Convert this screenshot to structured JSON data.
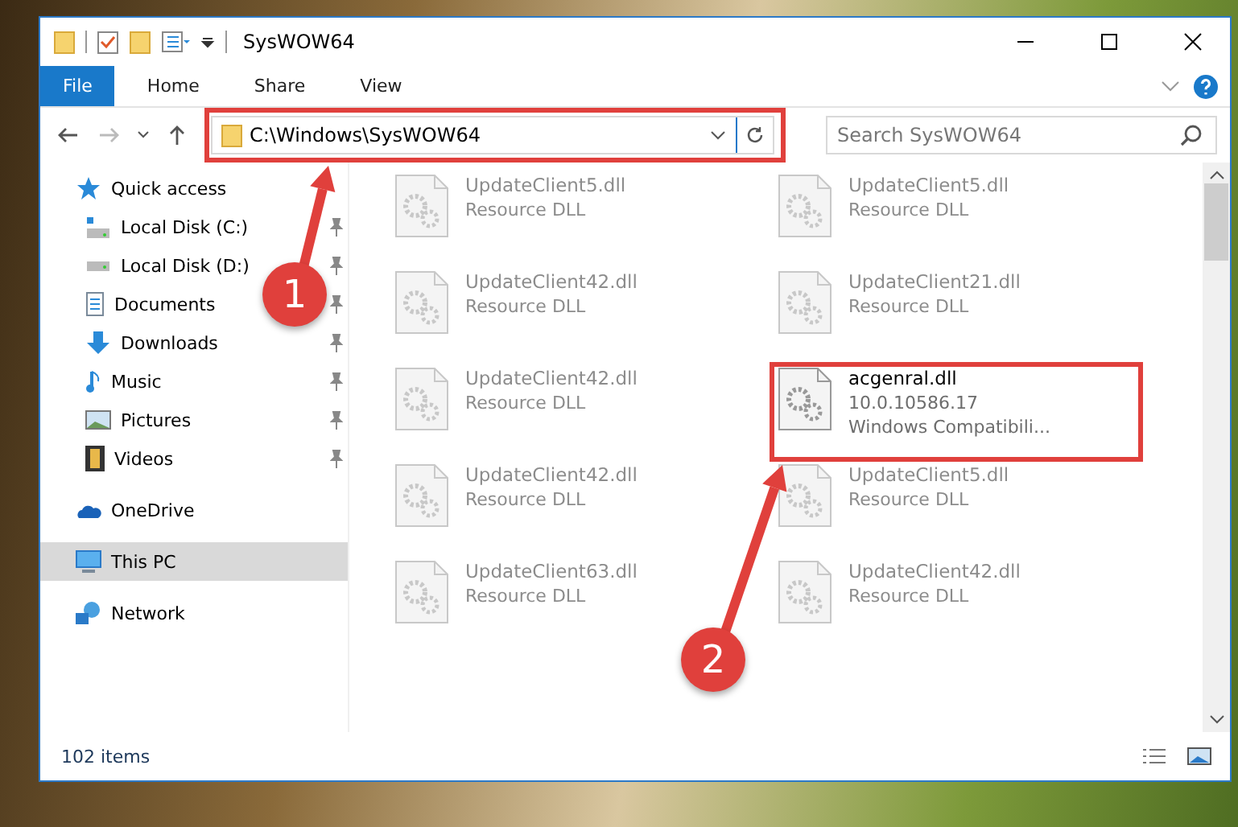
{
  "window": {
    "title": "SysWOW64"
  },
  "ribbon": {
    "tabs": [
      {
        "label": "File",
        "selected": true
      },
      {
        "label": "Home",
        "selected": false
      },
      {
        "label": "Share",
        "selected": false
      },
      {
        "label": "View",
        "selected": false
      }
    ]
  },
  "address_bar": {
    "path": "C:\\Windows\\SysWOW64"
  },
  "search": {
    "placeholder": "Search SysWOW64"
  },
  "sidebar": {
    "items": [
      {
        "label": "Quick access",
        "kind": "star",
        "selected": false,
        "children": [
          {
            "label": "Local Disk (C:)",
            "kind": "system-disk",
            "pinned": true
          },
          {
            "label": "Local Disk (D:)",
            "kind": "disk",
            "pinned": true
          },
          {
            "label": "Documents",
            "kind": "document",
            "pinned": true
          },
          {
            "label": "Downloads",
            "kind": "download",
            "pinned": true
          },
          {
            "label": "Music",
            "kind": "music",
            "pinned": true
          },
          {
            "label": "Pictures",
            "kind": "picture",
            "pinned": true
          },
          {
            "label": "Videos",
            "kind": "video",
            "pinned": true
          }
        ]
      },
      {
        "label": "OneDrive",
        "kind": "cloud",
        "selected": false
      },
      {
        "label": "This PC",
        "kind": "computer",
        "selected": true
      },
      {
        "label": "Network",
        "kind": "network",
        "selected": false
      }
    ]
  },
  "files": [
    {
      "name": "UpdateClient5.dll",
      "lines": [
        "Resource DLL"
      ],
      "faded": true
    },
    {
      "name": "UpdateClient5.dll",
      "lines": [
        "Resource DLL"
      ],
      "faded": true
    },
    {
      "name": "UpdateClient42.dll",
      "lines": [
        "Resource DLL"
      ],
      "faded": true
    },
    {
      "name": "UpdateClient21.dll",
      "lines": [
        "Resource DLL"
      ],
      "faded": true
    },
    {
      "name": "UpdateClient42.dll",
      "lines": [
        "Resource DLL"
      ],
      "faded": true
    },
    {
      "name": "acgenral.dll",
      "lines": [
        "10.0.10586.17",
        "Windows Compatibili..."
      ],
      "faded": false
    },
    {
      "name": "UpdateClient42.dll",
      "lines": [
        "Resource DLL"
      ],
      "faded": true
    },
    {
      "name": "UpdateClient5.dll",
      "lines": [
        "Resource DLL"
      ],
      "faded": true
    },
    {
      "name": "UpdateClient63.dll",
      "lines": [
        "Resource DLL"
      ],
      "faded": true
    },
    {
      "name": "UpdateClient42.dll",
      "lines": [
        "Resource DLL"
      ],
      "faded": true
    }
  ],
  "status_bar": {
    "count": "102 items"
  },
  "annotations": [
    {
      "number": "1"
    },
    {
      "number": "2"
    }
  ]
}
